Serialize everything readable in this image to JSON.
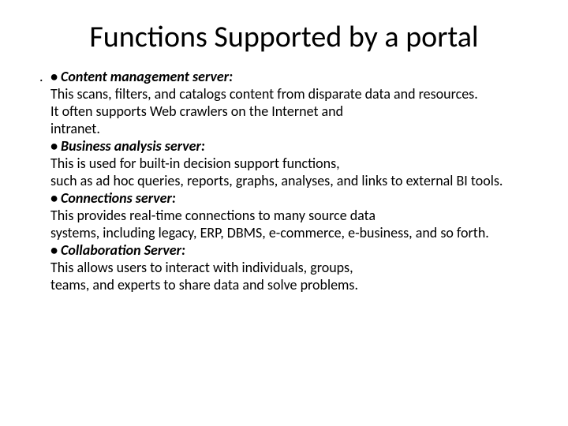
{
  "title": "Functions Supported by a portal",
  "marker": ".",
  "h1": "• Content management server:",
  "l1a": " This scans, filters, and catalogs content from disparate data and resources.",
  "l1b": "It often supports Web crawlers on the Internet and",
  "l1c": "intranet.",
  "h2": "• Business analysis server:",
  "l2a": " This is used for built-in decision support functions,",
  "l2b": "such as ad hoc queries, reports, graphs, analyses, and links to external BI tools.",
  "h3": "• Connections server:",
  "l3a": "This provides real-time connections to many source data",
  "l3b": "systems, including legacy, ERP, DBMS, e-commerce, e-business, and so forth.",
  "h4": "• Collaboration Server:",
  "l4a": "This allows users to interact with individuals, groups,",
  "l4b": "teams, and experts to share data and solve problems."
}
